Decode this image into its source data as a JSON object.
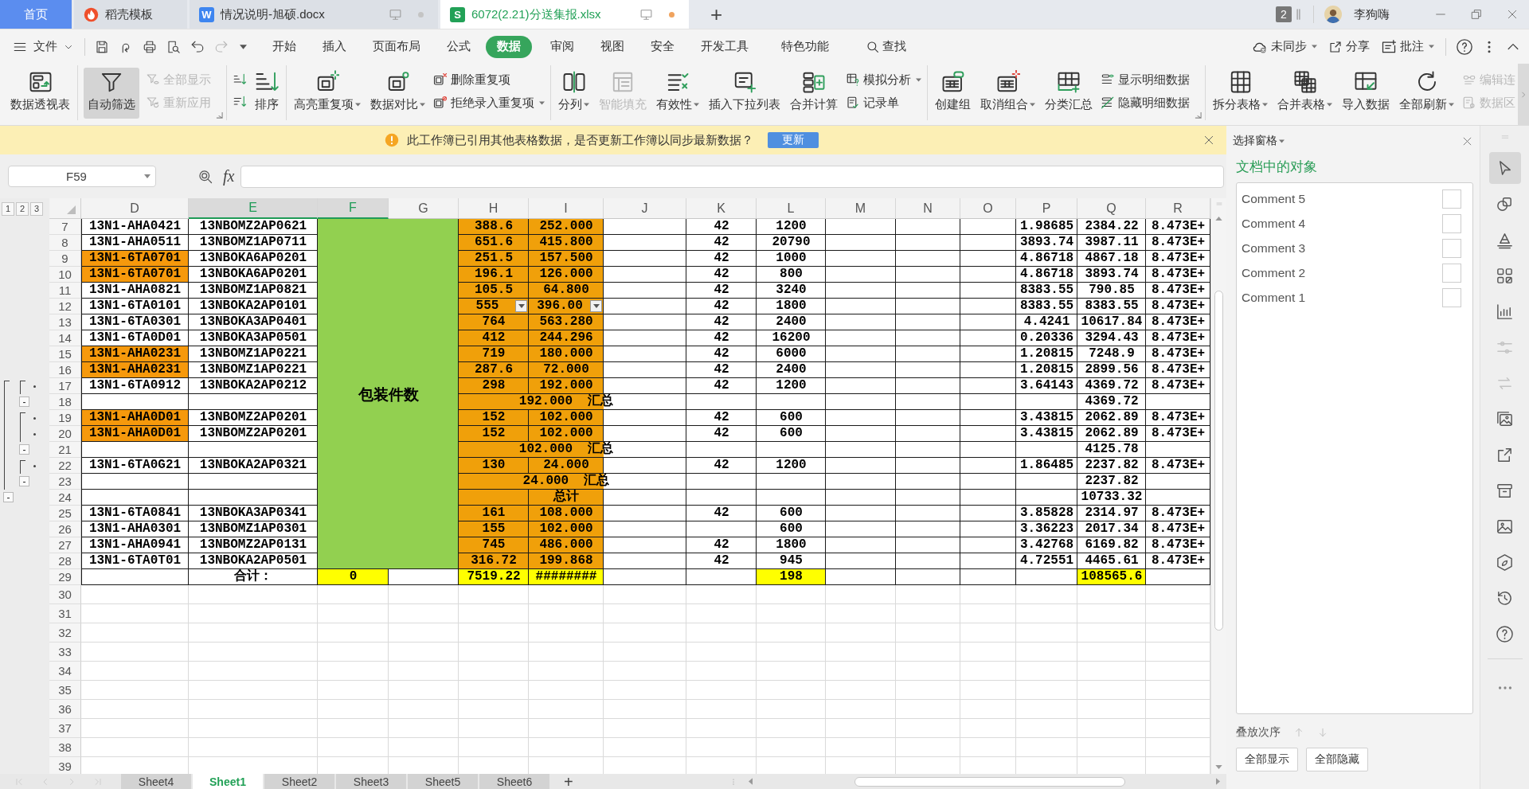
{
  "tabs": [
    {
      "label": "首页",
      "kind": "home",
      "selected": false
    },
    {
      "label": "稻壳模板",
      "kind": "docer",
      "selected": false
    },
    {
      "label": "情况说明-旭硕.docx",
      "kind": "writer",
      "logo": "W",
      "selected": false,
      "unsaved": false
    },
    {
      "label": "6072(2.21)分送集报.xlsx",
      "kind": "sheet",
      "logo": "S",
      "selected": true,
      "unsaved": true
    }
  ],
  "new_tab": "+",
  "account": {
    "window_count": "2",
    "name": "李狗嗨"
  },
  "menu": {
    "file": "文件",
    "tabs": [
      {
        "label": "开始",
        "selected": false
      },
      {
        "label": "插入",
        "selected": false
      },
      {
        "label": "页面布局",
        "selected": false
      },
      {
        "label": "公式",
        "selected": false
      },
      {
        "label": "数据",
        "selected": true
      },
      {
        "label": "审阅",
        "selected": false
      },
      {
        "label": "视图",
        "selected": false
      },
      {
        "label": "安全",
        "selected": false
      },
      {
        "label": "开发工具",
        "selected": false
      },
      {
        "label": "特色功能",
        "selected": false
      }
    ],
    "search": "查找",
    "sync": "未同步",
    "share": "分享",
    "comment": "批注"
  },
  "quick_access": [
    {
      "disabled": false
    },
    {
      "disabled": false
    },
    {
      "disabled": false
    },
    {
      "disabled": false
    },
    {
      "disabled": false
    },
    {
      "disabled": true
    }
  ],
  "ribbon": {
    "groups": [
      {
        "items": [
          {
            "kind": "large",
            "label": "数据透视表",
            "disabled": false,
            "pressed": false
          }
        ]
      },
      {
        "launcher": true,
        "items": [
          {
            "kind": "large",
            "label": "自动筛选",
            "disabled": false,
            "pressed": true
          },
          {
            "kind": "stack",
            "buttons": [
              {
                "label": "全部显示",
                "disabled": true
              },
              {
                "label": "重新应用",
                "disabled": true
              }
            ]
          }
        ]
      },
      {
        "items": [
          {
            "kind": "icons",
            "buttons": [
              {
                "disabled": false
              },
              {
                "disabled": false
              }
            ]
          },
          {
            "kind": "large",
            "label": "排序",
            "disabled": false,
            "pressed": false
          }
        ]
      },
      {
        "items": [
          {
            "kind": "large",
            "label": "高亮重复项",
            "dropdown": true,
            "disabled": false,
            "pressed": false
          },
          {
            "kind": "large",
            "label": "数据对比",
            "dropdown": true,
            "disabled": false,
            "pressed": false
          },
          {
            "kind": "stack",
            "buttons": [
              {
                "label": "删除重复项",
                "disabled": false
              },
              {
                "label": "拒绝录入重复项",
                "dropdown": true,
                "disabled": false
              }
            ]
          }
        ]
      },
      {
        "items": [
          {
            "kind": "large",
            "label": "分列",
            "dropdown": true,
            "disabled": false,
            "pressed": false
          },
          {
            "kind": "large",
            "label": "智能填充",
            "disabled": true,
            "pressed": false
          },
          {
            "kind": "large",
            "label": "有效性",
            "dropdown": true,
            "disabled": false,
            "pressed": false
          },
          {
            "kind": "large",
            "label": "插入下拉列表",
            "disabled": false,
            "pressed": false
          },
          {
            "kind": "large",
            "label": "合并计算",
            "disabled": false,
            "pressed": false
          },
          {
            "kind": "stack",
            "buttons": [
              {
                "label": "模拟分析",
                "dropdown": true,
                "disabled": false
              },
              {
                "label": "记录单",
                "disabled": false
              }
            ]
          }
        ]
      },
      {
        "launcher": true,
        "items": [
          {
            "kind": "large",
            "label": "创建组",
            "disabled": false,
            "pressed": false
          },
          {
            "kind": "large",
            "label": "取消组合",
            "dropdown": true,
            "disabled": false,
            "pressed": false
          },
          {
            "kind": "large",
            "label": "分类汇总",
            "disabled": false,
            "pressed": false
          },
          {
            "kind": "stack",
            "buttons": [
              {
                "label": "显示明细数据",
                "disabled": false
              },
              {
                "label": "隐藏明细数据",
                "disabled": false
              }
            ]
          }
        ]
      },
      {
        "items": [
          {
            "kind": "large",
            "label": "拆分表格",
            "dropdown": true,
            "disabled": false,
            "pressed": false
          },
          {
            "kind": "large",
            "label": "合并表格",
            "dropdown": true,
            "disabled": false,
            "pressed": false
          },
          {
            "kind": "large",
            "label": "导入数据",
            "disabled": false,
            "pressed": false
          },
          {
            "kind": "large",
            "label": "全部刷新",
            "dropdown": true,
            "disabled": false,
            "pressed": false
          },
          {
            "kind": "stack",
            "buttons": [
              {
                "label": "编辑连",
                "disabled": true
              },
              {
                "label": "数据区",
                "disabled": true
              }
            ]
          }
        ]
      }
    ]
  },
  "notice": {
    "message": "此工作簿已引用其他表格数据，是否更新工作簿以同步最新数据？",
    "button": "更新"
  },
  "formula_bar": {
    "name_box": "F59",
    "fx": "fx"
  },
  "outline_levels": [
    "1",
    "2",
    "3"
  ],
  "columns": [
    {
      "label": "D",
      "selected": false
    },
    {
      "label": "E",
      "selected": true
    },
    {
      "label": "F",
      "selected": true
    },
    {
      "label": "G",
      "selected": false
    },
    {
      "label": "H",
      "selected": false
    },
    {
      "label": "I",
      "selected": false
    },
    {
      "label": "J",
      "selected": false
    },
    {
      "label": "K",
      "selected": false
    },
    {
      "label": "L",
      "selected": false
    },
    {
      "label": "M",
      "selected": false
    },
    {
      "label": "N",
      "selected": false
    },
    {
      "label": "O",
      "selected": false
    },
    {
      "label": "P",
      "selected": false
    },
    {
      "label": "Q",
      "selected": false
    },
    {
      "label": "R",
      "selected": false
    }
  ],
  "rows": [
    {
      "label": "7",
      "cells": [
        {
          "kind": "plain",
          "text": "13N1-AHA0421"
        },
        {
          "kind": "plain",
          "text": "13NBOMZ2AP0621"
        },
        {
          "kind": "merge-anchor",
          "text": "包装件数",
          "color": "#92d050"
        },
        {
          "kind": "merged"
        },
        {
          "kind": "plain",
          "text": "388.6",
          "color": "#f0a00a"
        },
        {
          "kind": "plain",
          "text": "252.000",
          "color": "#f0a00a"
        },
        {
          "kind": "empty"
        },
        {
          "kind": "plain",
          "text": "42"
        },
        {
          "kind": "plain",
          "text": "1200"
        },
        {
          "kind": "empty"
        },
        {
          "kind": "empty"
        },
        {
          "kind": "empty"
        },
        {
          "kind": "plain",
          "text": "1.98685"
        },
        {
          "kind": "plain",
          "text": "2384.22"
        },
        {
          "kind": "plain",
          "text": "8.473E+"
        }
      ]
    },
    {
      "label": "8",
      "cells": [
        {
          "kind": "plain",
          "text": "13N1-AHA0511"
        },
        {
          "kind": "plain",
          "text": "13NBOMZ1AP0711"
        },
        {
          "kind": "merged"
        },
        {
          "kind": "merged"
        },
        {
          "kind": "plain",
          "text": "651.6",
          "color": "#f0a00a"
        },
        {
          "kind": "plain",
          "text": "415.800",
          "color": "#f0a00a"
        },
        {
          "kind": "empty"
        },
        {
          "kind": "plain",
          "text": "42"
        },
        {
          "kind": "plain",
          "text": "20790"
        },
        {
          "kind": "empty"
        },
        {
          "kind": "empty"
        },
        {
          "kind": "empty"
        },
        {
          "kind": "plain",
          "text": "3893.74"
        },
        {
          "kind": "plain",
          "text": "3987.11"
        },
        {
          "kind": "plain",
          "text": "8.473E+"
        }
      ]
    },
    {
      "label": "9",
      "cells": [
        {
          "kind": "plain",
          "text": "13N1-6TA0701",
          "color": "#f6990c"
        },
        {
          "kind": "plain",
          "text": "13NBOKA6AP0201"
        },
        {
          "kind": "merged"
        },
        {
          "kind": "merged"
        },
        {
          "kind": "plain",
          "text": "251.5",
          "color": "#f0a00a"
        },
        {
          "kind": "plain",
          "text": "157.500",
          "color": "#f0a00a"
        },
        {
          "kind": "empty"
        },
        {
          "kind": "plain",
          "text": "42"
        },
        {
          "kind": "plain",
          "text": "1000"
        },
        {
          "kind": "empty"
        },
        {
          "kind": "empty"
        },
        {
          "kind": "empty"
        },
        {
          "kind": "plain",
          "text": "4.86718"
        },
        {
          "kind": "plain",
          "text": "4867.18"
        },
        {
          "kind": "plain",
          "text": "8.473E+"
        }
      ]
    },
    {
      "label": "10",
      "cells": [
        {
          "kind": "plain",
          "text": "13N1-6TA0701",
          "color": "#f6990c"
        },
        {
          "kind": "plain",
          "text": "13NBOKA6AP0201"
        },
        {
          "kind": "merged"
        },
        {
          "kind": "merged"
        },
        {
          "kind": "plain",
          "text": "196.1",
          "color": "#f0a00a"
        },
        {
          "kind": "plain",
          "text": "126.000",
          "color": "#f0a00a"
        },
        {
          "kind": "empty"
        },
        {
          "kind": "plain",
          "text": "42"
        },
        {
          "kind": "plain",
          "text": "800"
        },
        {
          "kind": "empty"
        },
        {
          "kind": "empty"
        },
        {
          "kind": "empty"
        },
        {
          "kind": "plain",
          "text": "4.86718"
        },
        {
          "kind": "plain",
          "text": "3893.74"
        },
        {
          "kind": "plain",
          "text": "8.473E+"
        }
      ]
    },
    {
      "label": "11",
      "cells": [
        {
          "kind": "plain",
          "text": "13N1-AHA0821"
        },
        {
          "kind": "plain",
          "text": "13NBOMZ1AP0821"
        },
        {
          "kind": "merged"
        },
        {
          "kind": "merged"
        },
        {
          "kind": "plain",
          "text": "105.5",
          "color": "#f0a00a"
        },
        {
          "kind": "plain",
          "text": "64.800",
          "color": "#f0a00a"
        },
        {
          "kind": "empty"
        },
        {
          "kind": "plain",
          "text": "42"
        },
        {
          "kind": "plain",
          "text": "3240"
        },
        {
          "kind": "empty"
        },
        {
          "kind": "empty"
        },
        {
          "kind": "empty"
        },
        {
          "kind": "plain",
          "text": "8383.55"
        },
        {
          "kind": "plain",
          "text": "790.85"
        },
        {
          "kind": "plain",
          "text": "8.473E+"
        }
      ]
    },
    {
      "label": "12",
      "cells": [
        {
          "kind": "plain",
          "text": "13N1-6TA0101"
        },
        {
          "kind": "plain",
          "text": "13NBOKA2AP0101"
        },
        {
          "kind": "merged"
        },
        {
          "kind": "merged"
        },
        {
          "kind": "dropdown",
          "text": "555",
          "color": "#f0a00a"
        },
        {
          "kind": "dropdown",
          "text": "396.00",
          "color": "#f0a00a"
        },
        {
          "kind": "empty"
        },
        {
          "kind": "plain",
          "text": "42"
        },
        {
          "kind": "plain",
          "text": "1800"
        },
        {
          "kind": "empty"
        },
        {
          "kind": "empty"
        },
        {
          "kind": "empty"
        },
        {
          "kind": "plain",
          "text": "8383.55"
        },
        {
          "kind": "plain",
          "text": "8383.55"
        },
        {
          "kind": "plain",
          "text": "8.473E+"
        }
      ]
    },
    {
      "label": "13",
      "cells": [
        {
          "kind": "plain",
          "text": "13N1-6TA0301"
        },
        {
          "kind": "plain",
          "text": "13NBOKA3AP0401"
        },
        {
          "kind": "merged"
        },
        {
          "kind": "merged"
        },
        {
          "kind": "plain",
          "text": "764",
          "color": "#f0a00a"
        },
        {
          "kind": "plain",
          "text": "563.280",
          "color": "#f0a00a"
        },
        {
          "kind": "empty"
        },
        {
          "kind": "plain",
          "text": "42"
        },
        {
          "kind": "plain",
          "text": "2400"
        },
        {
          "kind": "empty"
        },
        {
          "kind": "empty"
        },
        {
          "kind": "empty"
        },
        {
          "kind": "plain",
          "text": "4.4241"
        },
        {
          "kind": "plain",
          "text": "10617.84"
        },
        {
          "kind": "plain",
          "text": "8.473E+"
        }
      ]
    },
    {
      "label": "14",
      "cells": [
        {
          "kind": "plain",
          "text": "13N1-6TA0D01"
        },
        {
          "kind": "plain",
          "text": "13NBOKA3AP0501"
        },
        {
          "kind": "merged"
        },
        {
          "kind": "merged"
        },
        {
          "kind": "plain",
          "text": "412",
          "color": "#f0a00a"
        },
        {
          "kind": "plain",
          "text": "244.296",
          "color": "#f0a00a"
        },
        {
          "kind": "empty"
        },
        {
          "kind": "plain",
          "text": "42"
        },
        {
          "kind": "plain",
          "text": "16200"
        },
        {
          "kind": "empty"
        },
        {
          "kind": "empty"
        },
        {
          "kind": "empty"
        },
        {
          "kind": "plain",
          "text": "0.20336"
        },
        {
          "kind": "plain",
          "text": "3294.43"
        },
        {
          "kind": "plain",
          "text": "8.473E+"
        }
      ]
    },
    {
      "label": "15",
      "cells": [
        {
          "kind": "plain",
          "text": "13N1-AHA0231",
          "color": "#f6990c"
        },
        {
          "kind": "plain",
          "text": "13NBOMZ1AP0221"
        },
        {
          "kind": "merged"
        },
        {
          "kind": "merged"
        },
        {
          "kind": "plain",
          "text": "719",
          "color": "#f0a00a"
        },
        {
          "kind": "plain",
          "text": "180.000",
          "color": "#f0a00a"
        },
        {
          "kind": "empty"
        },
        {
          "kind": "plain",
          "text": "42"
        },
        {
          "kind": "plain",
          "text": "6000"
        },
        {
          "kind": "empty"
        },
        {
          "kind": "empty"
        },
        {
          "kind": "empty"
        },
        {
          "kind": "plain",
          "text": "1.20815"
        },
        {
          "kind": "plain",
          "text": "7248.9"
        },
        {
          "kind": "plain",
          "text": "8.473E+"
        }
      ]
    },
    {
      "label": "16",
      "cells": [
        {
          "kind": "plain",
          "text": "13N1-AHA0231",
          "color": "#f6990c"
        },
        {
          "kind": "plain",
          "text": "13NBOMZ1AP0221"
        },
        {
          "kind": "merged"
        },
        {
          "kind": "merged"
        },
        {
          "kind": "plain",
          "text": "287.6",
          "color": "#f0a00a"
        },
        {
          "kind": "plain",
          "text": "72.000",
          "color": "#f0a00a"
        },
        {
          "kind": "empty"
        },
        {
          "kind": "plain",
          "text": "42"
        },
        {
          "kind": "plain",
          "text": "2400"
        },
        {
          "kind": "empty"
        },
        {
          "kind": "empty"
        },
        {
          "kind": "empty"
        },
        {
          "kind": "plain",
          "text": "1.20815"
        },
        {
          "kind": "plain",
          "text": "2899.56"
        },
        {
          "kind": "plain",
          "text": "8.473E+"
        }
      ]
    },
    {
      "label": "17",
      "outline": [
        {
          "kind": "outer-line"
        },
        {
          "kind": "inner-line"
        },
        {
          "kind": "detail"
        }
      ],
      "cells": [
        {
          "kind": "plain",
          "text": "13N1-6TA0912"
        },
        {
          "kind": "plain",
          "text": "13NBOKA2AP0212"
        },
        {
          "kind": "merged"
        },
        {
          "kind": "merged"
        },
        {
          "kind": "plain",
          "text": "298",
          "color": "#f0a00a"
        },
        {
          "kind": "plain",
          "text": "192.000",
          "color": "#f0a00a"
        },
        {
          "kind": "empty"
        },
        {
          "kind": "plain",
          "text": "42"
        },
        {
          "kind": "plain",
          "text": "1200"
        },
        {
          "kind": "empty"
        },
        {
          "kind": "empty"
        },
        {
          "kind": "empty"
        },
        {
          "kind": "plain",
          "text": "3.64143"
        },
        {
          "kind": "plain",
          "text": "4369.72"
        },
        {
          "kind": "plain",
          "text": "8.473E+"
        }
      ]
    },
    {
      "label": "18",
      "outline": [
        {
          "kind": "outer-line"
        },
        {
          "kind": "inner-collapse",
          "label": "-"
        }
      ],
      "cells": [
        {
          "kind": "empty"
        },
        {
          "kind": "empty"
        },
        {
          "kind": "merged"
        },
        {
          "kind": "merged"
        },
        {
          "kind": "empty",
          "color": "#f0a00a"
        },
        {
          "kind": "overflow",
          "text": "192.000  汇总",
          "color": "#f0a00a"
        },
        {
          "kind": "empty"
        },
        {
          "kind": "empty"
        },
        {
          "kind": "empty"
        },
        {
          "kind": "empty"
        },
        {
          "kind": "empty"
        },
        {
          "kind": "empty"
        },
        {
          "kind": "empty"
        },
        {
          "kind": "plain",
          "text": "4369.72"
        },
        {
          "kind": "empty"
        }
      ]
    },
    {
      "label": "19",
      "outline": [
        {
          "kind": "outer-line"
        },
        {
          "kind": "inner-line"
        },
        {
          "kind": "detail"
        }
      ],
      "cells": [
        {
          "kind": "plain",
          "text": "13N1-AHA0D01",
          "color": "#f6990c"
        },
        {
          "kind": "plain",
          "text": "13NBOMZ2AP0201"
        },
        {
          "kind": "merged"
        },
        {
          "kind": "merged"
        },
        {
          "kind": "plain",
          "text": "152",
          "color": "#f0a00a"
        },
        {
          "kind": "plain",
          "text": "102.000",
          "color": "#f0a00a"
        },
        {
          "kind": "empty"
        },
        {
          "kind": "plain",
          "text": "42"
        },
        {
          "kind": "plain",
          "text": "600"
        },
        {
          "kind": "empty"
        },
        {
          "kind": "empty"
        },
        {
          "kind": "empty"
        },
        {
          "kind": "plain",
          "text": "3.43815"
        },
        {
          "kind": "plain",
          "text": "2062.89"
        },
        {
          "kind": "plain",
          "text": "8.473E+"
        }
      ]
    },
    {
      "label": "20",
      "outline": [
        {
          "kind": "outer-line"
        },
        {
          "kind": "inner-line"
        },
        {
          "kind": "detail"
        }
      ],
      "cells": [
        {
          "kind": "plain",
          "text": "13N1-AHA0D01",
          "color": "#f6990c"
        },
        {
          "kind": "plain",
          "text": "13NBOMZ2AP0201"
        },
        {
          "kind": "merged"
        },
        {
          "kind": "merged"
        },
        {
          "kind": "plain",
          "text": "152",
          "color": "#f0a00a"
        },
        {
          "kind": "plain",
          "text": "102.000",
          "color": "#f0a00a"
        },
        {
          "kind": "empty"
        },
        {
          "kind": "plain",
          "text": "42"
        },
        {
          "kind": "plain",
          "text": "600"
        },
        {
          "kind": "empty"
        },
        {
          "kind": "empty"
        },
        {
          "kind": "empty"
        },
        {
          "kind": "plain",
          "text": "3.43815"
        },
        {
          "kind": "plain",
          "text": "2062.89"
        },
        {
          "kind": "plain",
          "text": "8.473E+"
        }
      ]
    },
    {
      "label": "21",
      "outline": [
        {
          "kind": "outer-line"
        },
        {
          "kind": "inner-collapse",
          "label": "-"
        }
      ],
      "cells": [
        {
          "kind": "empty"
        },
        {
          "kind": "empty"
        },
        {
          "kind": "merged"
        },
        {
          "kind": "merged"
        },
        {
          "kind": "empty",
          "color": "#f0a00a"
        },
        {
          "kind": "overflow",
          "text": "102.000  汇总",
          "color": "#f0a00a"
        },
        {
          "kind": "empty"
        },
        {
          "kind": "empty"
        },
        {
          "kind": "empty"
        },
        {
          "kind": "empty"
        },
        {
          "kind": "empty"
        },
        {
          "kind": "empty"
        },
        {
          "kind": "empty"
        },
        {
          "kind": "plain",
          "text": "4125.78"
        },
        {
          "kind": "empty"
        }
      ]
    },
    {
      "label": "22",
      "outline": [
        {
          "kind": "outer-line"
        },
        {
          "kind": "inner-line"
        },
        {
          "kind": "detail"
        }
      ],
      "cells": [
        {
          "kind": "plain",
          "text": "13N1-6TA0G21"
        },
        {
          "kind": "plain",
          "text": "13NBOKA2AP0321"
        },
        {
          "kind": "merged"
        },
        {
          "kind": "merged"
        },
        {
          "kind": "plain",
          "text": "130",
          "color": "#f0a00a"
        },
        {
          "kind": "plain",
          "text": "24.000",
          "color": "#f0a00a"
        },
        {
          "kind": "empty"
        },
        {
          "kind": "plain",
          "text": "42"
        },
        {
          "kind": "plain",
          "text": "1200"
        },
        {
          "kind": "empty"
        },
        {
          "kind": "empty"
        },
        {
          "kind": "empty"
        },
        {
          "kind": "plain",
          "text": "1.86485"
        },
        {
          "kind": "plain",
          "text": "2237.82"
        },
        {
          "kind": "plain",
          "text": "8.473E+"
        }
      ]
    },
    {
      "label": "23",
      "outline": [
        {
          "kind": "outer-line"
        },
        {
          "kind": "inner-collapse",
          "label": "-"
        }
      ],
      "cells": [
        {
          "kind": "empty"
        },
        {
          "kind": "empty"
        },
        {
          "kind": "merged"
        },
        {
          "kind": "merged"
        },
        {
          "kind": "empty",
          "color": "#f0a00a"
        },
        {
          "kind": "overflow",
          "text": "24.000  汇总",
          "color": "#f0a00a"
        },
        {
          "kind": "empty"
        },
        {
          "kind": "empty"
        },
        {
          "kind": "empty"
        },
        {
          "kind": "empty"
        },
        {
          "kind": "empty"
        },
        {
          "kind": "empty"
        },
        {
          "kind": "empty"
        },
        {
          "kind": "plain",
          "text": "2237.82"
        },
        {
          "kind": "empty"
        }
      ]
    },
    {
      "label": "24",
      "outline": [
        {
          "kind": "outer-collapse",
          "label": "-"
        }
      ],
      "cells": [
        {
          "kind": "empty"
        },
        {
          "kind": "empty"
        },
        {
          "kind": "merged"
        },
        {
          "kind": "merged"
        },
        {
          "kind": "empty",
          "color": "#f0a00a"
        },
        {
          "kind": "plain",
          "text": "总计",
          "color": "#f0a00a"
        },
        {
          "kind": "empty"
        },
        {
          "kind": "empty"
        },
        {
          "kind": "empty"
        },
        {
          "kind": "empty"
        },
        {
          "kind": "empty"
        },
        {
          "kind": "empty"
        },
        {
          "kind": "empty"
        },
        {
          "kind": "plain",
          "text": "10733.32"
        },
        {
          "kind": "empty"
        }
      ]
    },
    {
      "label": "25",
      "cells": [
        {
          "kind": "plain",
          "text": "13N1-6TA0841"
        },
        {
          "kind": "plain",
          "text": "13NBOKA3AP0341"
        },
        {
          "kind": "merged"
        },
        {
          "kind": "merged"
        },
        {
          "kind": "plain",
          "text": "161",
          "color": "#f0a00a"
        },
        {
          "kind": "plain",
          "text": "108.000",
          "color": "#f0a00a"
        },
        {
          "kind": "empty"
        },
        {
          "kind": "plain",
          "text": "42"
        },
        {
          "kind": "plain",
          "text": "600"
        },
        {
          "kind": "empty"
        },
        {
          "kind": "empty"
        },
        {
          "kind": "empty"
        },
        {
          "kind": "plain",
          "text": "3.85828"
        },
        {
          "kind": "plain",
          "text": "2314.97"
        },
        {
          "kind": "plain",
          "text": "8.473E+"
        }
      ]
    },
    {
      "label": "26",
      "cells": [
        {
          "kind": "plain",
          "text": "13N1-AHA0301"
        },
        {
          "kind": "plain",
          "text": "13NBOMZ1AP0301"
        },
        {
          "kind": "merged"
        },
        {
          "kind": "merged"
        },
        {
          "kind": "plain",
          "text": "155",
          "color": "#f0a00a"
        },
        {
          "kind": "plain",
          "text": "102.000",
          "color": "#f0a00a"
        },
        {
          "kind": "empty"
        },
        {
          "kind": "empty"
        },
        {
          "kind": "plain",
          "text": "600"
        },
        {
          "kind": "empty"
        },
        {
          "kind": "empty"
        },
        {
          "kind": "empty"
        },
        {
          "kind": "plain",
          "text": "3.36223"
        },
        {
          "kind": "plain",
          "text": "2017.34"
        },
        {
          "kind": "plain",
          "text": "8.473E+"
        }
      ]
    },
    {
      "label": "27",
      "cells": [
        {
          "kind": "plain",
          "text": "13N1-AHA0941"
        },
        {
          "kind": "plain",
          "text": "13NBOMZ2AP0131"
        },
        {
          "kind": "merged"
        },
        {
          "kind": "merged"
        },
        {
          "kind": "plain",
          "text": "745",
          "color": "#f0a00a"
        },
        {
          "kind": "plain",
          "text": "486.000",
          "color": "#f0a00a"
        },
        {
          "kind": "empty"
        },
        {
          "kind": "plain",
          "text": "42"
        },
        {
          "kind": "plain",
          "text": "1800"
        },
        {
          "kind": "empty"
        },
        {
          "kind": "empty"
        },
        {
          "kind": "empty"
        },
        {
          "kind": "plain",
          "text": "3.42768"
        },
        {
          "kind": "plain",
          "text": "6169.82"
        },
        {
          "kind": "plain",
          "text": "8.473E+"
        }
      ]
    },
    {
      "label": "28",
      "cells": [
        {
          "kind": "plain",
          "text": "13N1-6TA0T01"
        },
        {
          "kind": "plain",
          "text": "13NBOKA2AP0501"
        },
        {
          "kind": "merged"
        },
        {
          "kind": "merged"
        },
        {
          "kind": "plain",
          "text": "316.72",
          "color": "#f0a00a"
        },
        {
          "kind": "plain",
          "text": "199.868",
          "color": "#f0a00a"
        },
        {
          "kind": "empty"
        },
        {
          "kind": "plain",
          "text": "42"
        },
        {
          "kind": "plain",
          "text": "945"
        },
        {
          "kind": "empty"
        },
        {
          "kind": "empty"
        },
        {
          "kind": "empty"
        },
        {
          "kind": "plain",
          "text": "4.72551"
        },
        {
          "kind": "plain",
          "text": "4465.61"
        },
        {
          "kind": "plain",
          "text": "8.473E+"
        }
      ]
    },
    {
      "label": "29",
      "cells": [
        {
          "kind": "empty"
        },
        {
          "kind": "plain",
          "text": "合计："
        },
        {
          "kind": "plain",
          "text": "0",
          "color": "#ffff00"
        },
        {
          "kind": "empty"
        },
        {
          "kind": "plain",
          "text": "7519.22",
          "color": "#ffff00"
        },
        {
          "kind": "plain",
          "text": "########",
          "color": "#ffff00"
        },
        {
          "kind": "empty"
        },
        {
          "kind": "empty"
        },
        {
          "kind": "plain",
          "text": "198",
          "color": "#ffff00"
        },
        {
          "kind": "empty"
        },
        {
          "kind": "empty"
        },
        {
          "kind": "empty"
        },
        {
          "kind": "empty"
        },
        {
          "kind": "plain",
          "text": "108565.6",
          "color": "#ffff00"
        },
        {
          "kind": "empty"
        }
      ]
    },
    {
      "label": "30"
    },
    {
      "label": "31"
    },
    {
      "label": "32"
    },
    {
      "label": "33"
    },
    {
      "label": "34"
    },
    {
      "label": "35"
    },
    {
      "label": "36"
    },
    {
      "label": "37"
    },
    {
      "label": "38"
    },
    {
      "label": "39"
    }
  ],
  "sheets": [
    {
      "label": "Sheet4",
      "selected": false
    },
    {
      "label": "Sheet1",
      "selected": true
    },
    {
      "label": "Sheet2",
      "selected": false
    },
    {
      "label": "Sheet3",
      "selected": false
    },
    {
      "label": "Sheet5",
      "selected": false
    },
    {
      "label": "Sheet6",
      "selected": false
    }
  ],
  "add_sheet": "+",
  "selection_pane": {
    "title": "选择窗格",
    "heading": "文档中的对象",
    "objects": [
      {
        "label": "Comment 5",
        "checked": false
      },
      {
        "label": "Comment 4",
        "checked": false
      },
      {
        "label": "Comment 3",
        "checked": false
      },
      {
        "label": "Comment 2",
        "checked": false
      },
      {
        "label": "Comment 1",
        "checked": false
      }
    ],
    "order_label": "叠放次序",
    "buttons": [
      "全部显示",
      "全部隐藏"
    ]
  },
  "side_tools": [
    {
      "selected": true,
      "disabled": false
    },
    {
      "selected": false,
      "disabled": false
    },
    {
      "selected": false,
      "disabled": false
    },
    {
      "selected": false,
      "disabled": false
    },
    {
      "selected": false,
      "disabled": false
    },
    {
      "selected": false,
      "disabled": true
    },
    {
      "selected": false,
      "disabled": true
    },
    {
      "selected": false,
      "disabled": false
    },
    {
      "selected": false,
      "disabled": false
    },
    {
      "selected": false,
      "disabled": false
    },
    {
      "selected": false,
      "disabled": false
    },
    {
      "selected": false,
      "disabled": false
    },
    {
      "selected": false,
      "disabled": false
    },
    {
      "selected": false,
      "disabled": false
    }
  ]
}
